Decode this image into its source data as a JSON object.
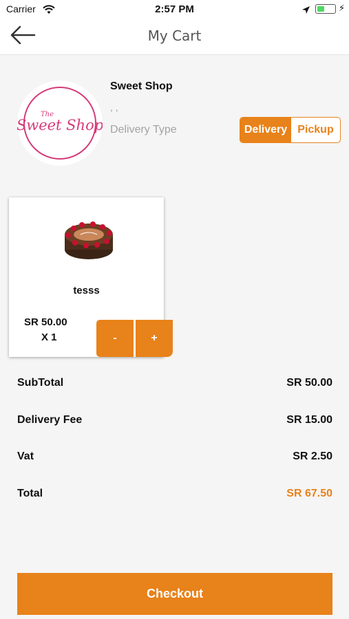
{
  "status_bar": {
    "carrier": "Carrier",
    "time": "2:57 PM",
    "battery_level": 0.45
  },
  "nav": {
    "title": "My Cart",
    "back_icon": "back-arrow-icon"
  },
  "shop": {
    "name": "Sweet Shop",
    "address": ", ,",
    "delivery_type_label": "Delivery Type",
    "logo_small": "The",
    "logo_main": "Sweet Shop",
    "logo_color": "#d63a7a",
    "delivery_options": [
      {
        "label": "Delivery",
        "selected": true
      },
      {
        "label": "Pickup",
        "selected": false
      }
    ]
  },
  "cart_items": [
    {
      "name": "tesss",
      "price": "SR 50.00",
      "quantity": "X 1",
      "image_icon": "cake-image",
      "minus_label": "-",
      "plus_label": "+"
    }
  ],
  "summary": {
    "subtotal_label": "SubTotal",
    "subtotal_value": "SR 50.00",
    "delivery_fee_label": "Delivery Fee",
    "delivery_fee_value": "SR 15.00",
    "vat_label": "Vat",
    "vat_value": "SR 2.50",
    "total_label": "Total",
    "total_value": "SR 67.50"
  },
  "checkout_label": "Checkout",
  "colors": {
    "accent": "#e8821a",
    "background": "#f5f5f5"
  }
}
